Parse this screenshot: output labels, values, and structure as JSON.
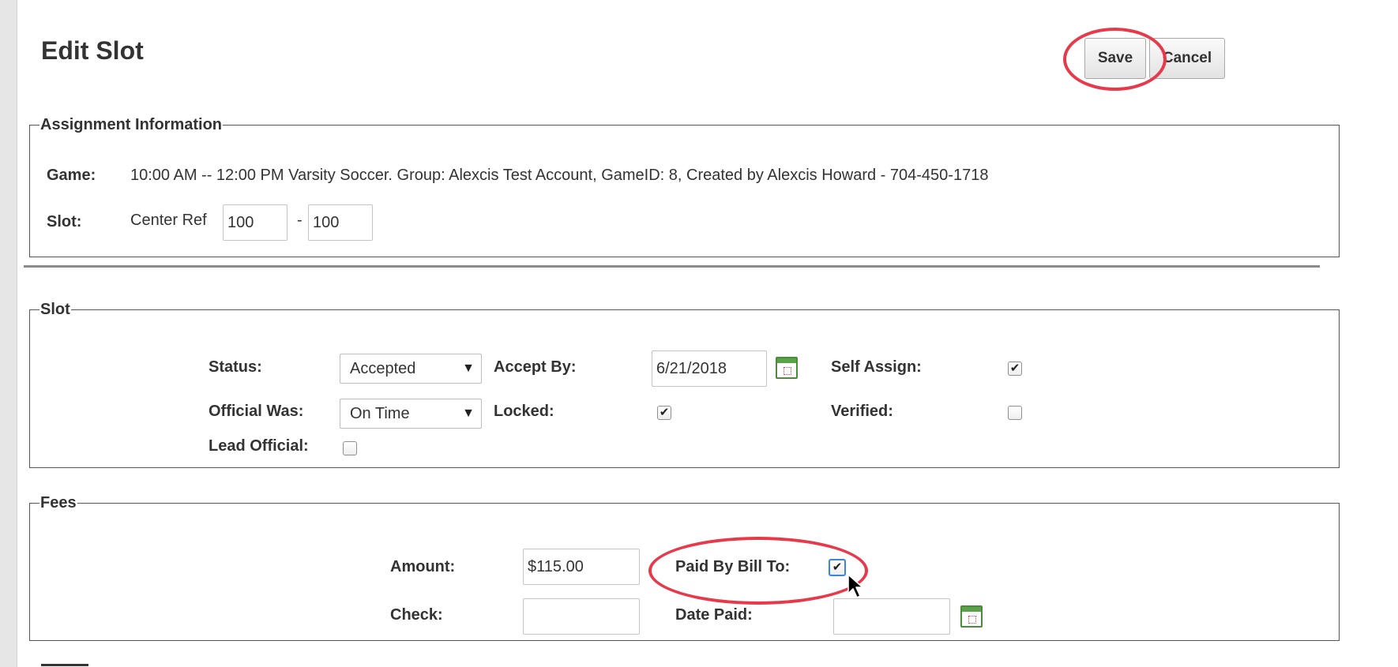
{
  "header": {
    "title": "Edit Slot",
    "save_label": "Save",
    "cancel_label": "Cancel"
  },
  "assignment": {
    "legend": "Assignment Information",
    "game_label": "Game:",
    "game_value": "10:00 AM -- 12:00 PM Varsity Soccer. Group: Alexcis Test Account, GameID: 8, Created by Alexcis Howard - 704-450-1718",
    "slot_label": "Slot:",
    "slot_position": "Center Ref",
    "slot_from": "100",
    "slot_sep": "-",
    "slot_to": "100"
  },
  "slot": {
    "legend": "Slot",
    "status_label": "Status:",
    "status_value": "Accepted",
    "accept_by_label": "Accept By:",
    "accept_by_value": "6/21/2018",
    "self_assign_label": "Self Assign:",
    "self_assign_checked": true,
    "official_was_label": "Official Was:",
    "official_was_value": "On Time",
    "locked_label": "Locked:",
    "locked_checked": true,
    "verified_label": "Verified:",
    "verified_checked": false,
    "lead_official_label": "Lead Official:",
    "lead_official_checked": false
  },
  "fees": {
    "legend": "Fees",
    "amount_label": "Amount:",
    "amount_value": "$115.00",
    "paid_by_bill_to_label": "Paid By Bill To:",
    "paid_by_bill_to_checked": true,
    "check_label": "Check:",
    "check_value": "",
    "date_paid_label": "Date Paid:",
    "date_paid_value": ""
  },
  "annotations": {
    "highlight_color": "#e8394a"
  }
}
